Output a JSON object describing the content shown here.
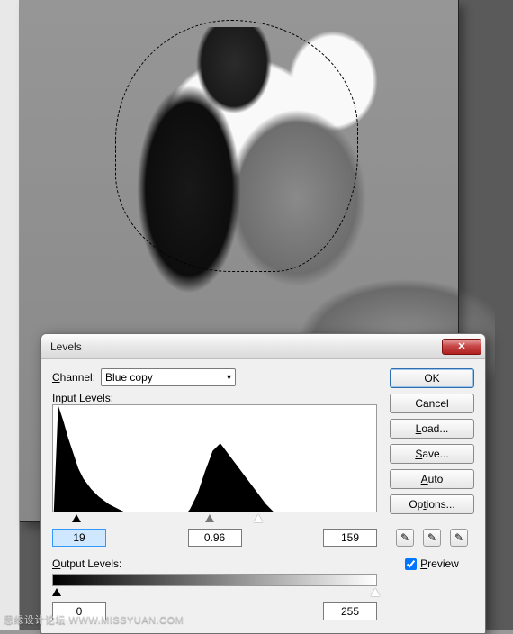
{
  "dialog": {
    "title": "Levels",
    "channel_label": "Channel:",
    "channel_value": "Blue copy",
    "input_levels_label": "Input Levels:",
    "input_black": "19",
    "input_gamma": "0.96",
    "input_white": "159",
    "output_levels_label": "Output Levels:",
    "output_black": "0",
    "output_white": "255"
  },
  "buttons": {
    "ok": "OK",
    "cancel": "Cancel",
    "load": "Load...",
    "save": "Save...",
    "auto": "Auto",
    "options": "Options..."
  },
  "preview": {
    "label": "Preview",
    "checked": true
  },
  "watermark": "思缘设计论坛 WWW.MISSYUAN.COM",
  "icons": {
    "close": "✕",
    "chevron_down": "▾",
    "dropper": "✎"
  },
  "chart_data": {
    "type": "area",
    "title": "",
    "xlabel": "",
    "ylabel": "",
    "xlim": [
      0,
      255
    ],
    "ylim": [
      0,
      100
    ],
    "series": [
      {
        "name": "histogram",
        "x": [
          0,
          4,
          8,
          12,
          16,
          20,
          24,
          30,
          36,
          44,
          52,
          60,
          70,
          80,
          90,
          100,
          108,
          114,
          120,
          126,
          132,
          138,
          144,
          150,
          156,
          162,
          168,
          176,
          186,
          200,
          220,
          240,
          255
        ],
        "values": [
          2,
          100,
          88,
          74,
          62,
          50,
          42,
          34,
          28,
          22,
          18,
          14,
          10,
          8,
          7,
          8,
          18,
          30,
          48,
          64,
          70,
          62,
          54,
          46,
          38,
          30,
          22,
          14,
          8,
          4,
          2,
          1,
          0
        ]
      }
    ],
    "input_sliders": {
      "black": 19,
      "gamma": 0.96,
      "white": 159
    },
    "output_sliders": {
      "black": 0,
      "white": 255
    }
  }
}
